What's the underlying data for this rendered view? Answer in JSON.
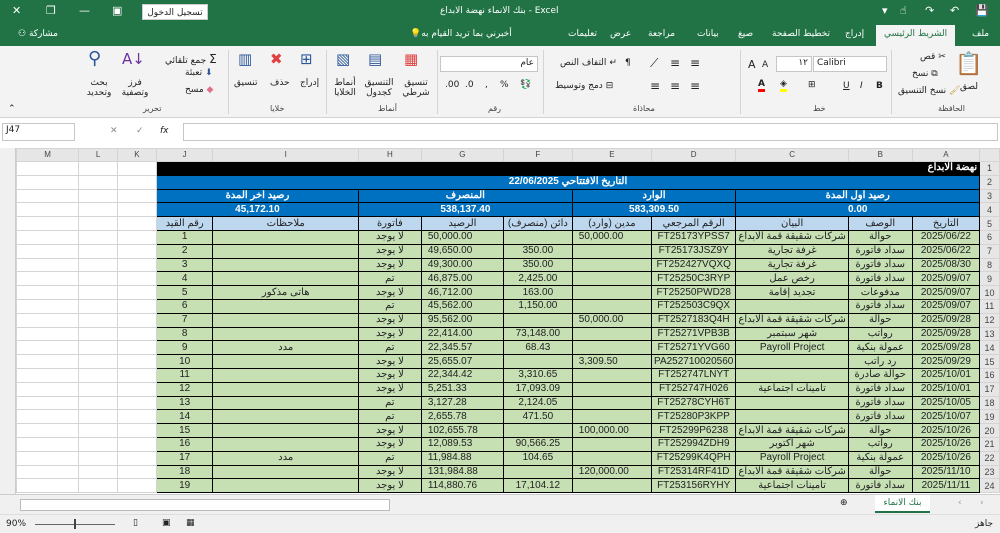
{
  "app": {
    "title": "بنك الانماء نهضة الابداع  -  Excel",
    "sign_in": "تسجيل الدخول",
    "share": "مشاركة",
    "tell_me": "أخبرني بما تريد القيام به"
  },
  "tabs": [
    "ملف",
    "الشريط الرئيسي",
    "إدراج",
    "تخطيط الصفحة",
    "صيغ",
    "بيانات",
    "مراجعة",
    "عرض",
    "تعليمات"
  ],
  "ribbon": {
    "clipboard": {
      "label": "الحافظة",
      "paste": "لصق",
      "cut": "قص",
      "copy": "نسخ",
      "format_painter": "نسخ التنسيق"
    },
    "font": {
      "label": "خط",
      "font_name": "Calibri",
      "font_size": "١٢",
      "bold": "B",
      "italic": "I",
      "underline": "U"
    },
    "alignment": {
      "label": "محاذاة",
      "wrap": "التفاف النص",
      "merge": "دمج وتوسيط"
    },
    "number": {
      "label": "رقم",
      "format": "عام"
    },
    "styles": {
      "label": "أنماط",
      "conditional": "تنسيق شرطي",
      "as_table": "التنسيق كجدول",
      "cell_styles": "أنماط الخلايا"
    },
    "cells": {
      "label": "خلايا",
      "insert": "إدراج",
      "delete": "حذف",
      "format": "تنسيق"
    },
    "editing": {
      "label": "تحرير",
      "autosum": "جمع تلقائي",
      "fill": "تعبئة",
      "clear": "مسح",
      "sort": "فرز وتصفية",
      "find": "بحث وتحديد"
    }
  },
  "formula_bar": {
    "name_box": "J47",
    "fx": "fx",
    "value": ""
  },
  "columns": [
    "M",
    "L",
    "K",
    "J",
    "I",
    "H",
    "G",
    "F",
    "E",
    "D",
    "C",
    "B",
    "A"
  ],
  "sheet": {
    "title": "نهضة الابداع",
    "opening": "التاريخ الافتتاحي   22/06/2025",
    "summary_labels": {
      "closing": "رصيد اخر المدة",
      "out": "المنصرف",
      "in": "الوارد",
      "opening": "رصيد اول المدة"
    },
    "summary_values": {
      "closing": "45,172.10",
      "out": "538,137.40",
      "in": "583,309.50",
      "opening": "0.00"
    },
    "headers": {
      "date": "التاريخ",
      "desc": "الوصف",
      "stmt": "البيان",
      "ref": "الرقم المرجعي",
      "debit": "مدين (وارد)",
      "credit": "دائن (منصرف)",
      "balance": "الرصيد",
      "invoice": "فاتورة",
      "notes": "ملاحظات",
      "entry": "رقم القيد"
    },
    "rows": [
      {
        "date": "2025/06/22",
        "desc": "حوالة",
        "stmt": "شركات شقيقة قمة الابداع",
        "ref": "FT25173YPSS7",
        "debit": "50,000.00",
        "credit": "",
        "balance": "50,000.00",
        "invoice": "لا يوجد",
        "notes": "",
        "entry": "1"
      },
      {
        "date": "2025/06/22",
        "desc": "سداد فاتورة",
        "stmt": "غرفة تجارية",
        "ref": "FT25173JSZ9Y",
        "debit": "",
        "credit": "350.00",
        "balance": "49,650.00",
        "invoice": "لا يوجد",
        "notes": "",
        "entry": "2"
      },
      {
        "date": "2025/08/30",
        "desc": "سداد فاتورة",
        "stmt": "غرفة تجارية",
        "ref": "FT252427VQXQ",
        "debit": "",
        "credit": "350.00",
        "balance": "49,300.00",
        "invoice": "لا يوجد",
        "notes": "",
        "entry": "3"
      },
      {
        "date": "2025/09/07",
        "desc": "سداد فاتورة",
        "stmt": "رخص عمل",
        "ref": "FT25250C3RYP",
        "debit": "",
        "credit": "2,425.00",
        "balance": "46,875.00",
        "invoice": "تم",
        "notes": "",
        "entry": "4"
      },
      {
        "date": "2025/09/07",
        "desc": "مدفوعات",
        "stmt": "تجديد إقامة",
        "ref": "FT25250PWD28",
        "debit": "",
        "credit": "163.00",
        "balance": "46,712.00",
        "invoice": "لا يوجد",
        "notes": "هاتى مذكور",
        "entry": "5"
      },
      {
        "date": "2025/09/07",
        "desc": "سداد فاتورة",
        "stmt": "",
        "ref": "FT252503C9QX",
        "debit": "",
        "credit": "1,150.00",
        "balance": "45,562.00",
        "invoice": "تم",
        "notes": "",
        "entry": "6"
      },
      {
        "date": "2025/09/28",
        "desc": "حوالة",
        "stmt": "شركات شقيقة قمة الابداع",
        "ref": "FT2527183Q4H",
        "debit": "50,000.00",
        "credit": "",
        "balance": "95,562.00",
        "invoice": "لا يوجد",
        "notes": "",
        "entry": "7"
      },
      {
        "date": "2025/09/28",
        "desc": "رواتب",
        "stmt": "شهر سبتمبر",
        "ref": "FT25271VPB3B",
        "debit": "",
        "credit": "73,148.00",
        "balance": "22,414.00",
        "invoice": "لا يوجد",
        "notes": "",
        "entry": "8"
      },
      {
        "date": "2025/09/28",
        "desc": "عمولة بنكية",
        "stmt": "Payroll Project",
        "ref": "FT25271YVG60",
        "debit": "",
        "credit": "68.43",
        "balance": "22,345.57",
        "invoice": "تم",
        "notes": "مدد",
        "entry": "9"
      },
      {
        "date": "2025/09/29",
        "desc": "رد راتب",
        "stmt": "",
        "ref": "PA252710020560",
        "debit": "3,309.50",
        "credit": "",
        "balance": "25,655.07",
        "invoice": "لا يوجد",
        "notes": "",
        "entry": "10"
      },
      {
        "date": "2025/10/01",
        "desc": "حوالة صادرة",
        "stmt": "",
        "ref": "FT252747LNYT",
        "debit": "",
        "credit": "3,310.65",
        "balance": "22,344.42",
        "invoice": "لا يوجد",
        "notes": "",
        "entry": "11"
      },
      {
        "date": "2025/10/01",
        "desc": "سداد فاتورة",
        "stmt": "تامينات اجتماعية",
        "ref": "FT252747H026",
        "debit": "",
        "credit": "17,093.09",
        "balance": "5,251.33",
        "invoice": "لا يوجد",
        "notes": "",
        "entry": "12"
      },
      {
        "date": "2025/10/05",
        "desc": "سداد فاتورة",
        "stmt": "",
        "ref": "FT25278CYH6T",
        "debit": "",
        "credit": "2,124.05",
        "balance": "3,127.28",
        "invoice": "تم",
        "notes": "",
        "entry": "13"
      },
      {
        "date": "2025/10/07",
        "desc": "سداد فاتورة",
        "stmt": "",
        "ref": "FT25280P3KPP",
        "debit": "",
        "credit": "471.50",
        "balance": "2,655.78",
        "invoice": "تم",
        "notes": "",
        "entry": "14"
      },
      {
        "date": "2025/10/26",
        "desc": "حوالة",
        "stmt": "شركات شقيقة قمة الابداع",
        "ref": "FT25299P6238",
        "debit": "100,000.00",
        "credit": "",
        "balance": "102,655.78",
        "invoice": "لا يوجد",
        "notes": "",
        "entry": "15"
      },
      {
        "date": "2025/10/26",
        "desc": "رواتب",
        "stmt": "شهر أكتوبر",
        "ref": "FT252994ZDH9",
        "debit": "",
        "credit": "90,566.25",
        "balance": "12,089.53",
        "invoice": "لا يوجد",
        "notes": "",
        "entry": "16"
      },
      {
        "date": "2025/10/26",
        "desc": "عمولة بنكية",
        "stmt": "Payroll Project",
        "ref": "FT25299K4QPH",
        "debit": "",
        "credit": "104.65",
        "balance": "11,984.88",
        "invoice": "تم",
        "notes": "مدد",
        "entry": "17"
      },
      {
        "date": "2025/11/10",
        "desc": "حوالة",
        "stmt": "شركات شقيقة قمة الابداع",
        "ref": "FT25314RF41D",
        "debit": "120,000.00",
        "credit": "",
        "balance": "131,984.88",
        "invoice": "لا يوجد",
        "notes": "",
        "entry": "18"
      },
      {
        "date": "2025/11/11",
        "desc": "سداد فاتورة",
        "stmt": "تامينات اجتماعية",
        "ref": "FT253156RYHY",
        "debit": "",
        "credit": "17,104.12",
        "balance": "114,880.76",
        "invoice": "لا يوجد",
        "notes": "",
        "entry": "19"
      }
    ]
  },
  "sheet_tabs": [
    "بنك الانماء"
  ],
  "status": {
    "ready": "جاهز",
    "zoom": "90%"
  },
  "colors": {
    "excel_green": "#217346",
    "title_black": "#000000",
    "header_blue": "#0070c0",
    "col_header": "#bdd7ee",
    "row_green": "#c6e0b4"
  }
}
